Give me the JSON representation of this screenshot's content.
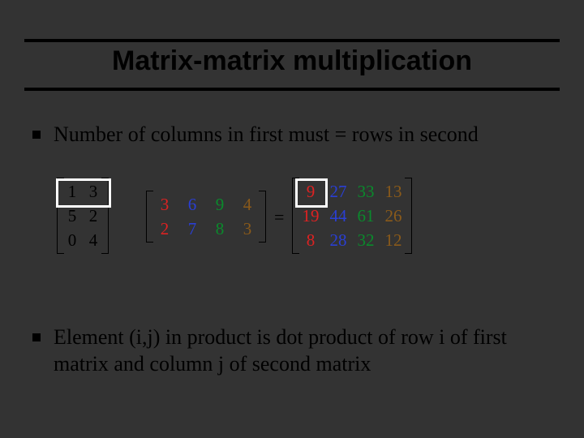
{
  "title": "Matrix-matrix multiplication",
  "bullets": {
    "b1": "Number of columns in first must  = rows in second",
    "b2": "Element (i,j) in product is dot product of row i of first matrix and column j of second matrix"
  },
  "equals": "=",
  "matrices": {
    "A": {
      "rows": [
        [
          {
            "v": "1",
            "c": "c-blk"
          },
          {
            "v": "3",
            "c": "c-blk"
          }
        ],
        [
          {
            "v": "5",
            "c": "c-blk"
          },
          {
            "v": "2",
            "c": "c-blk"
          }
        ],
        [
          {
            "v": "0",
            "c": "c-blk"
          },
          {
            "v": "4",
            "c": "c-blk"
          }
        ]
      ]
    },
    "B": {
      "rows": [
        [
          {
            "v": "3",
            "c": "c-red"
          },
          {
            "v": "6",
            "c": "c-blu"
          },
          {
            "v": "9",
            "c": "c-grn"
          },
          {
            "v": "4",
            "c": "c-brn"
          }
        ],
        [
          {
            "v": "2",
            "c": "c-red"
          },
          {
            "v": "7",
            "c": "c-blu"
          },
          {
            "v": "8",
            "c": "c-grn"
          },
          {
            "v": "3",
            "c": "c-brn"
          }
        ]
      ]
    },
    "C": {
      "rows": [
        [
          {
            "v": "9",
            "c": "c-red"
          },
          {
            "v": "27",
            "c": "c-blu"
          },
          {
            "v": "33",
            "c": "c-grn"
          },
          {
            "v": "13",
            "c": "c-brn"
          }
        ],
        [
          {
            "v": "19",
            "c": "c-red"
          },
          {
            "v": "44",
            "c": "c-blu"
          },
          {
            "v": "61",
            "c": "c-grn"
          },
          {
            "v": "26",
            "c": "c-brn"
          }
        ],
        [
          {
            "v": "8",
            "c": "c-red"
          },
          {
            "v": "28",
            "c": "c-blu"
          },
          {
            "v": "32",
            "c": "c-grn"
          },
          {
            "v": "12",
            "c": "c-brn"
          }
        ]
      ]
    }
  },
  "highlights": {
    "rowA": {
      "visible": true
    },
    "cellC": {
      "visible": true
    }
  }
}
